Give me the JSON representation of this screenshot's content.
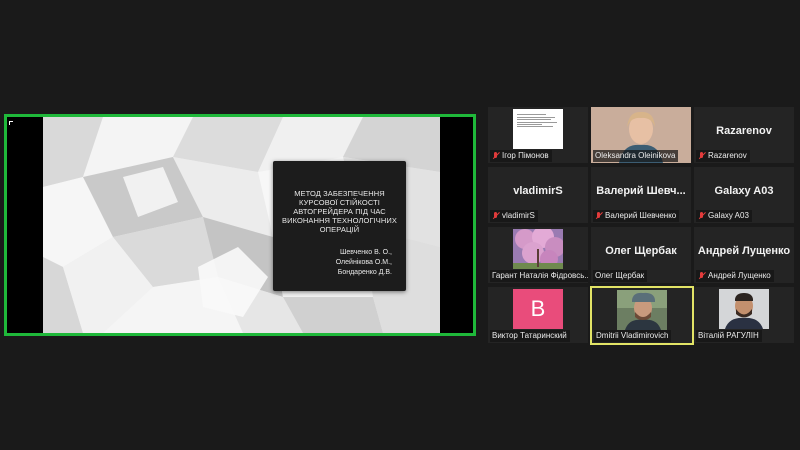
{
  "share": {
    "slide": {
      "title": "Метод забезпечення курсової стійкості автогрейдера під час виконання технологічних операцій",
      "authors": [
        "Шевченко В. О.,",
        "Олейнікова О.М.,",
        "Бондаренко Д.В."
      ]
    }
  },
  "gallery": [
    {
      "id": "igor",
      "name": "Ігор Пімонов",
      "muted": true,
      "view": "doc-thumbnail"
    },
    {
      "id": "oleksandra",
      "name": "Oleksandra Oleinikova",
      "muted": false,
      "view": "video"
    },
    {
      "id": "razarenov",
      "name": "Razarenov",
      "display": "Razarenov",
      "muted": true,
      "view": "name"
    },
    {
      "id": "vladimirs",
      "name": "vladimirS",
      "display": "vladimirS",
      "muted": true,
      "view": "name"
    },
    {
      "id": "valeriy",
      "name": "Валерий Шевченко",
      "display": "Валерий Шевч...",
      "muted": true,
      "view": "name"
    },
    {
      "id": "galaxy",
      "name": "Galaxy A03",
      "display": "Galaxy A03",
      "muted": true,
      "view": "name"
    },
    {
      "id": "garant",
      "name": "Гарант Наталія Фідровсь...",
      "muted": false,
      "view": "blossom-photo"
    },
    {
      "id": "oleg",
      "name": "Олег Щербак",
      "display": "Олег Щербак",
      "muted": false,
      "view": "name"
    },
    {
      "id": "andrey",
      "name": "Андрей Лущенко",
      "display": "Андрей Лущенко",
      "muted": true,
      "view": "name"
    },
    {
      "id": "viktor",
      "name": "Виктор Татаринский",
      "avatar_letter": "B",
      "avatar_color": "#e94c7b",
      "muted": false,
      "view": "avatar"
    },
    {
      "id": "dmitrii",
      "name": "Dmitrii Vladimirovich",
      "muted": false,
      "view": "video",
      "active_speaker": true
    },
    {
      "id": "vitaliy",
      "name": "Віталій РАГУЛІН",
      "muted": false,
      "view": "video"
    }
  ],
  "colors": {
    "share_border": "#1fb83a",
    "active_speaker": "#e2e466",
    "muted_icon": "#e23b3b"
  }
}
